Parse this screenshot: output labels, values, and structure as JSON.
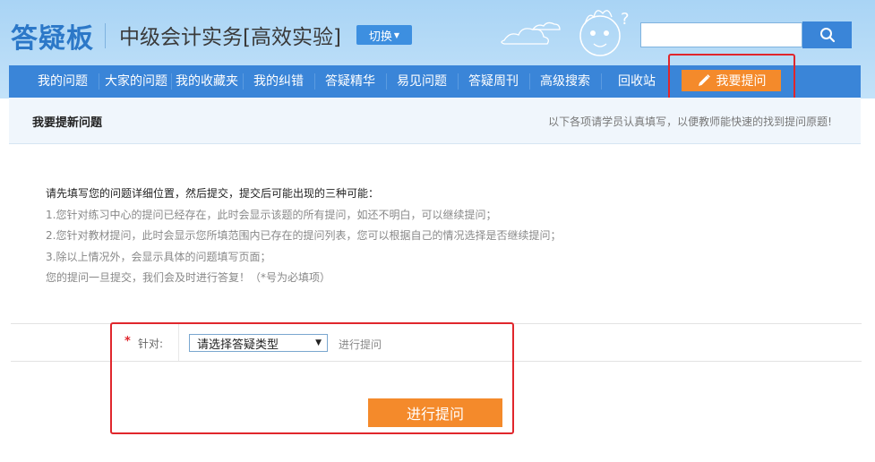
{
  "header": {
    "logo": "答疑板",
    "course_title": "中级会计实务[高效实验]",
    "switch_label": "切换",
    "search_placeholder": ""
  },
  "nav": {
    "items": [
      {
        "label": "我的问题"
      },
      {
        "label": "大家的问题"
      },
      {
        "label": "我的收藏夹"
      },
      {
        "label": "我的纠错"
      },
      {
        "label": "答疑精华"
      },
      {
        "label": "易见问题"
      },
      {
        "label": "答疑周刊"
      },
      {
        "label": "高级搜索"
      },
      {
        "label": "回收站"
      }
    ],
    "ask_button": "我要提问"
  },
  "subhead": {
    "title": "我要提新问题",
    "note": "以下各项请学员认真填写，以便教师能快速的找到提问原题!"
  },
  "instructions": {
    "lead": "请先填写您的问题详细位置，然后提交，提交后可能出现的三种可能：",
    "items": [
      "1.您针对练习中心的提问已经存在，此时会显示该题的所有提问，如还不明白，可以继续提问；",
      "2.您针对教材提问，此时会显示您所填范围内已存在的提问列表，您可以根据自己的情况选择是否继续提问；",
      "3.除以上情况外，会显示具体的问题填写页面；"
    ],
    "footer": "您的提问一旦提交，我们会及时进行答复！（*号为必填项）"
  },
  "form": {
    "required_mark": "*",
    "field_label": "针对:",
    "select_value": "请选择答疑类型",
    "hint": "进行提问",
    "submit_label": "进行提问"
  },
  "colors": {
    "accent": "#3a85d8",
    "button_orange": "#f48a2b",
    "highlight_red": "#e0262c"
  }
}
